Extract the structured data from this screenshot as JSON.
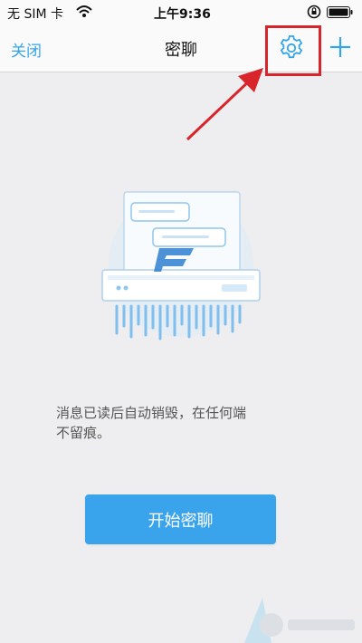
{
  "status_bar": {
    "carrier": "无 SIM 卡",
    "time": "上午9:36"
  },
  "nav": {
    "close_label": "关闭",
    "title": "密聊",
    "settings_icon": "gear-icon",
    "add_icon": "plus-icon"
  },
  "main": {
    "description_line1": "消息已读后自动销毁，在任何端",
    "description_line2": "不留痕。",
    "start_button_label": "开始密聊"
  },
  "colors": {
    "accent": "#35a5e8",
    "button": "#39a3ec",
    "annotation_red": "#d8252b",
    "background": "#eeeef0"
  }
}
